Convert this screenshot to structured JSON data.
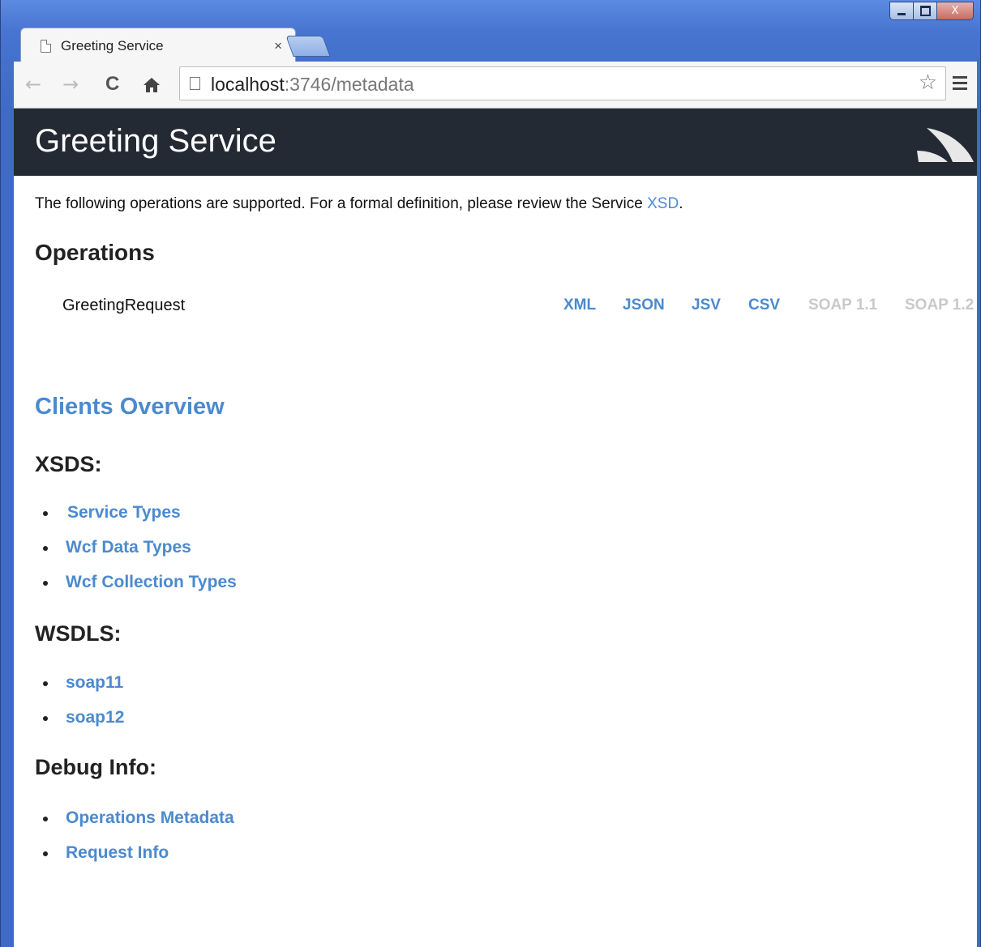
{
  "browser": {
    "tab_title": "Greeting Service",
    "tab_close": "×",
    "window_close": "X",
    "address_host": "localhost",
    "address_path": ":3746/metadata",
    "back": "←",
    "forward": "→",
    "reload": "C",
    "home": "🏠",
    "star": "☆"
  },
  "page": {
    "header_title": "Greeting Service",
    "intro_text": "The following operations are supported. For a formal definition, please review the Service ",
    "intro_link": "XSD",
    "intro_end": ".",
    "operations_heading": "Operations",
    "operation": {
      "name": "GreetingRequest",
      "formats": [
        {
          "label": "XML",
          "enabled": true
        },
        {
          "label": "JSON",
          "enabled": true
        },
        {
          "label": "JSV",
          "enabled": true
        },
        {
          "label": "CSV",
          "enabled": true
        },
        {
          "label": "SOAP 1.1",
          "enabled": false
        },
        {
          "label": "SOAP 1.2",
          "enabled": false
        }
      ]
    },
    "clients_overview": "Clients Overview",
    "xsds_heading": "XSDS:",
    "xsds": [
      "Service Types",
      "Wcf Data Types",
      "Wcf Collection Types"
    ],
    "wsdls_heading": "WSDLS:",
    "wsdls": [
      "soap11",
      "soap12"
    ],
    "debug_heading": "Debug Info:",
    "debug": [
      "Operations Metadata",
      "Request Info"
    ]
  },
  "colors": {
    "header_bg": "#232a33",
    "link": "#4b8acf",
    "disabled_link": "#c9c9c9"
  },
  "icons": [
    "page-icon",
    "back-arrow-icon",
    "forward-arrow-icon",
    "reload-icon",
    "home-icon",
    "star-icon",
    "menu-icon",
    "servicestack-logo-icon"
  ]
}
